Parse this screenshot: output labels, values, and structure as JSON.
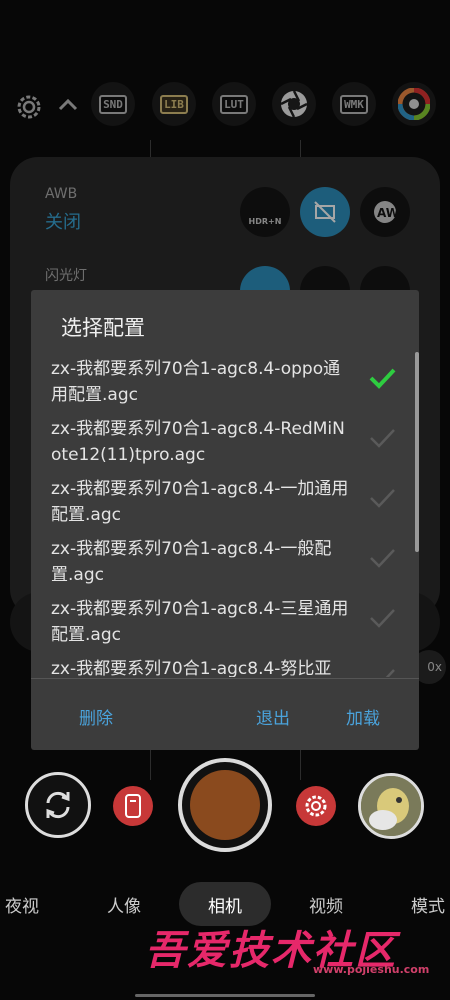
{
  "toolbar": {
    "items": [
      {
        "name": "snd-button",
        "label": "SND"
      },
      {
        "name": "lib-button",
        "label": "LIB"
      },
      {
        "name": "lut-button",
        "label": "LUT"
      },
      {
        "name": "wmk-button",
        "label": "WMK"
      }
    ]
  },
  "settings_panel": {
    "awb_label": "AWB",
    "awb_value": "关闭",
    "flash_label": "闪光灯",
    "hdr_mode_label": "HDR+N"
  },
  "dialog": {
    "title": "选择配置",
    "items": [
      {
        "text": "zx-我都要系列70合1-agc8.4-oppo通用配置.agc",
        "selected": true
      },
      {
        "text": "zx-我都要系列70合1-agc8.4-RedMiNote12(11)tpro.agc",
        "selected": false
      },
      {
        "text": "zx-我都要系列70合1-agc8.4-一加通用配置.agc",
        "selected": false
      },
      {
        "text": "zx-我都要系列70合1-agc8.4-一般配置.agc",
        "selected": false
      },
      {
        "text": "zx-我都要系列70合1-agc8.4-三星通用配置.agc",
        "selected": false
      },
      {
        "text": "zx-我都要系列70合1-agc8.4-努比亚",
        "selected": false
      }
    ],
    "delete_label": "删除",
    "exit_label": "退出",
    "load_label": "加载"
  },
  "zoom_partial": "0x",
  "modes": {
    "items": [
      "夜视",
      "人像",
      "相机",
      "视频",
      "模式"
    ],
    "active": "相机"
  },
  "watermark": {
    "text": "吾爱技术社区",
    "url": "www.pojieshu.com"
  },
  "colors": {
    "accent": "#4aa3dc",
    "check_active": "#2ecc40",
    "shutter": "#8a4a1e"
  }
}
